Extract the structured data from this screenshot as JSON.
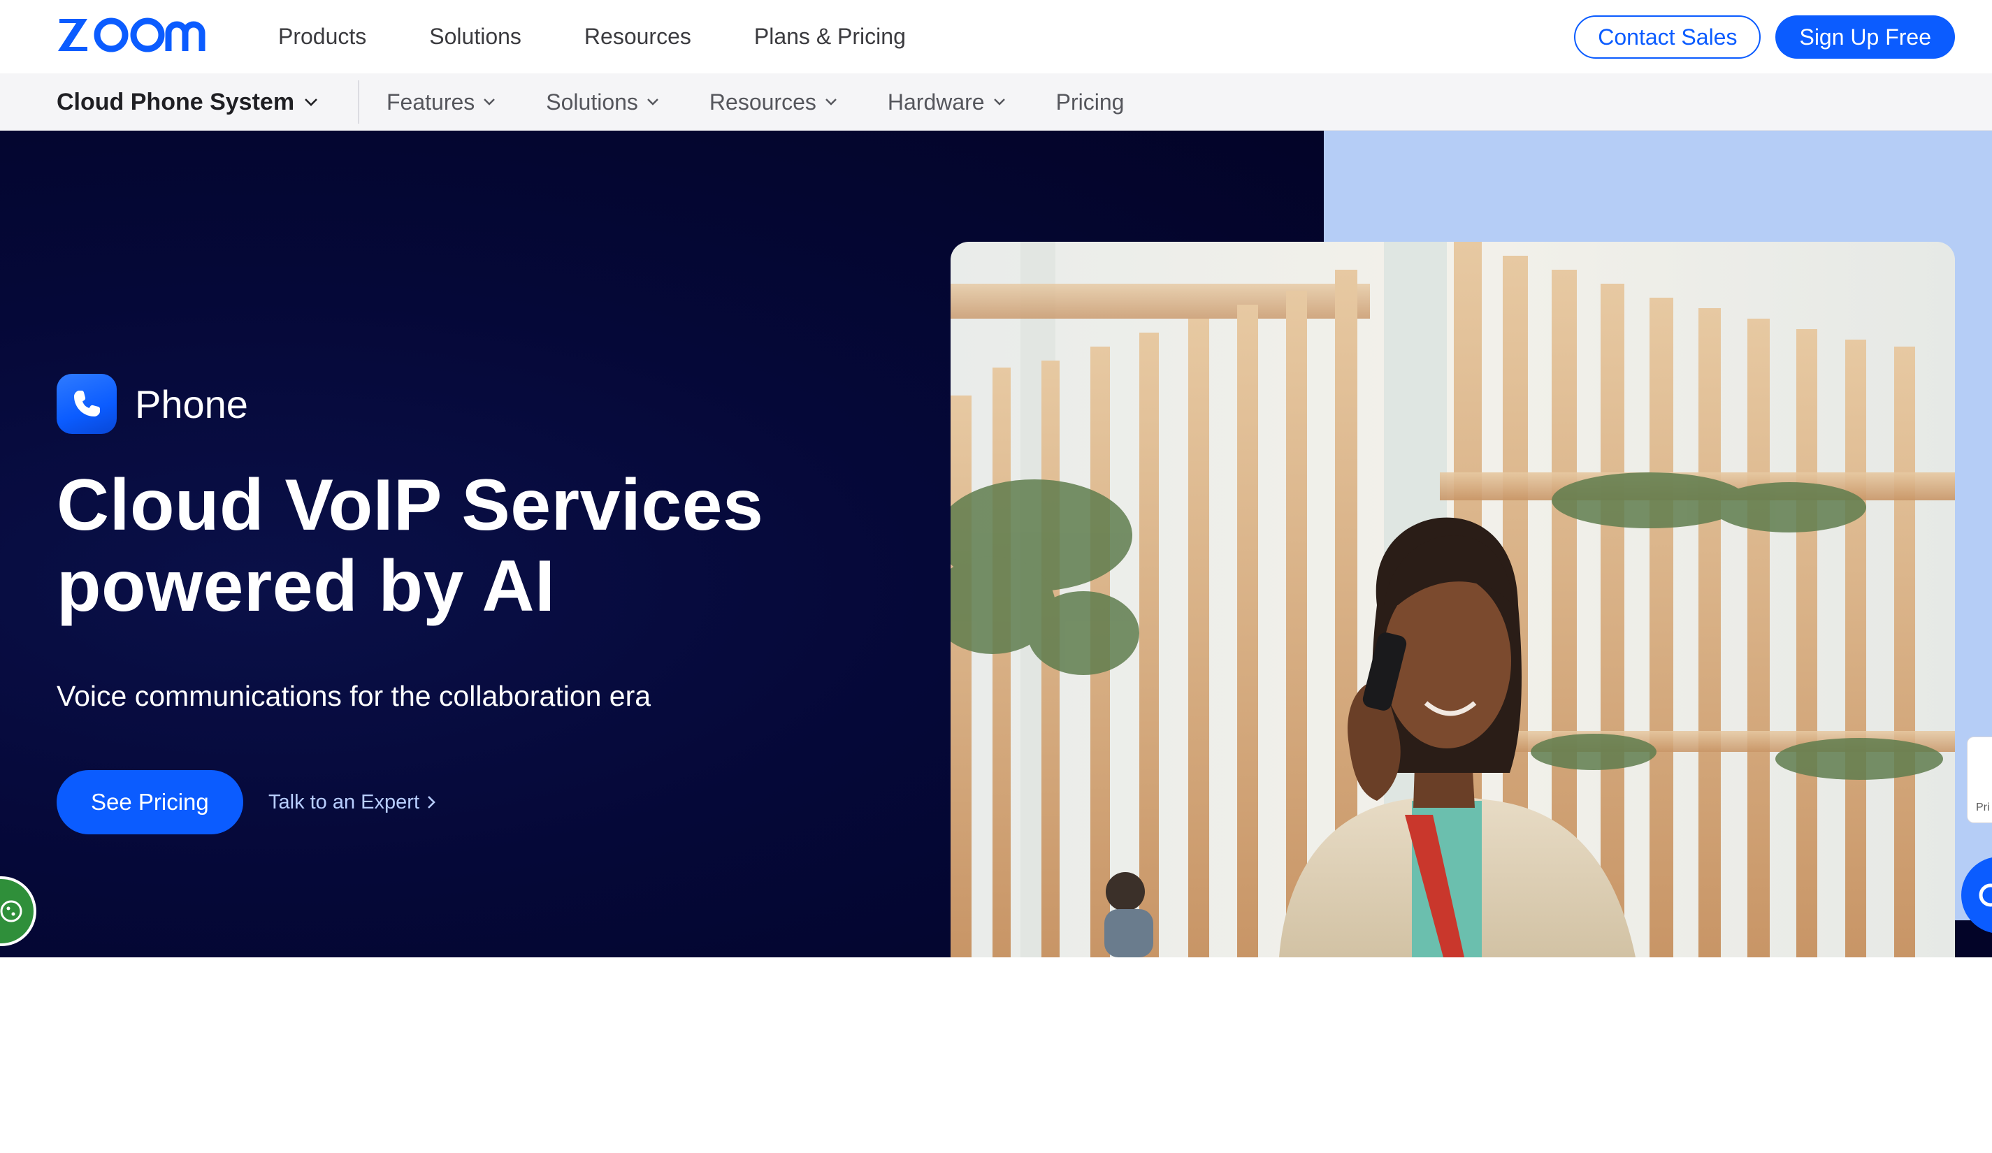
{
  "brand": {
    "logo_text": "zoom",
    "accent": "#0b5cff"
  },
  "topnav": {
    "links": [
      "Products",
      "Solutions",
      "Resources",
      "Plans & Pricing"
    ],
    "contact_sales": "Contact Sales",
    "sign_up": "Sign Up Free"
  },
  "subnav": {
    "product": "Cloud Phone System",
    "items": [
      "Features",
      "Solutions",
      "Resources",
      "Hardware",
      "Pricing"
    ]
  },
  "hero": {
    "product_name": "Phone",
    "title_line1": "Cloud VoIP Services",
    "title_line2": "powered by AI",
    "subtitle": "Voice communications for the collaboration era",
    "cta_primary": "See Pricing",
    "cta_secondary": "Talk to an Expert",
    "colors": {
      "dark_bg": "#030428",
      "light_panel": "#b5cdf6"
    }
  },
  "floating": {
    "side_tab_text": "Pri",
    "cookie_icon": "cookie-icon",
    "chat_icon": "chat-icon"
  }
}
